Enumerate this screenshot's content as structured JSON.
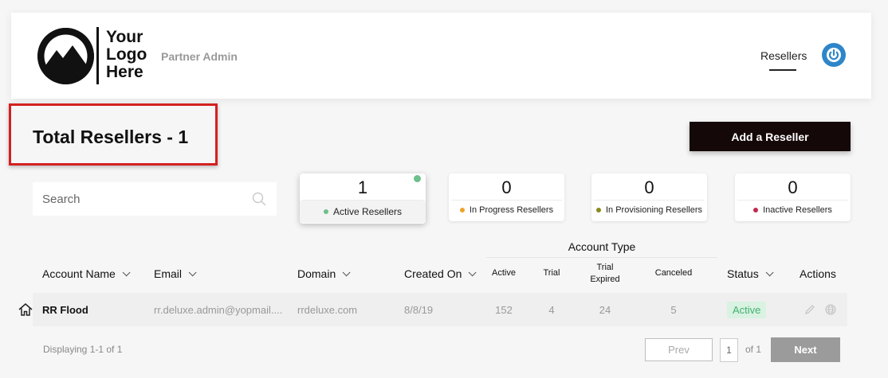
{
  "header": {
    "logo_lines": [
      "Your",
      "Logo",
      "Here"
    ],
    "subtitle": "Partner Admin",
    "nav_link": "Resellers",
    "power_icon": "power-icon"
  },
  "page_title": "Total Resellers - 1",
  "add_button": "Add a Reseller",
  "search": {
    "placeholder": "Search",
    "icon": "search-icon"
  },
  "cards": [
    {
      "count": "1",
      "label": "Active Resellers",
      "dot_color": "#6cc08b",
      "selected": true
    },
    {
      "count": "0",
      "label": "In Progress Resellers",
      "dot_color": "#f0a12a"
    },
    {
      "count": "0",
      "label": "In Provisioning Resellers",
      "dot_color": "#8a8a1e"
    },
    {
      "count": "0",
      "label": "Inactive Resellers",
      "dot_color": "#c2294e"
    }
  ],
  "table": {
    "group_header": "Account Type",
    "columns": {
      "account_name": "Account Name",
      "email": "Email",
      "domain": "Domain",
      "created_on": "Created On",
      "active": "Active",
      "trial": "Trial",
      "trial_expired_1": "Trial",
      "trial_expired_2": "Expired",
      "canceled": "Canceled",
      "status": "Status",
      "actions": "Actions"
    },
    "rows": [
      {
        "account_name": "RR Flood",
        "email": "rr.deluxe.admin@yopmail....",
        "domain": "rrdeluxe.com",
        "created_on": "8/8/19",
        "active": "152",
        "trial": "4",
        "trial_expired": "24",
        "canceled": "5",
        "status": "Active"
      }
    ]
  },
  "pagination": {
    "displaying": "Displaying 1-1 of 1",
    "prev": "Prev",
    "page": "1",
    "of": "of 1",
    "next": "Next"
  },
  "colors": {
    "accent_blue": "#2e86c9",
    "highlight_red": "#d42020",
    "add_button_bg": "#150808",
    "status_active_bg": "#d9f2e2",
    "status_active_text": "#43b06e"
  }
}
